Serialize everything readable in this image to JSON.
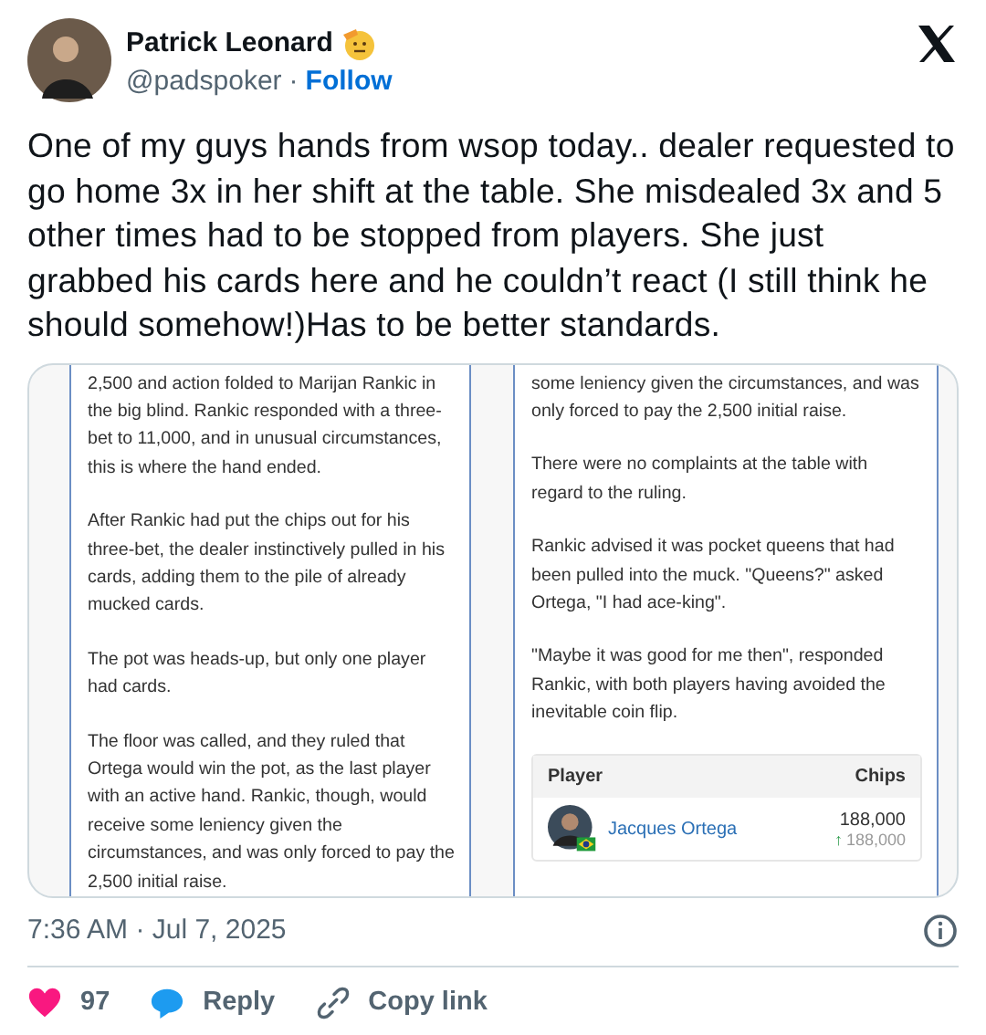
{
  "author": {
    "name": "Patrick Leonard",
    "handle": "@padspoker",
    "separator": "·",
    "follow": "Follow"
  },
  "text": "One of my guys hands from wsop today.. dealer requested to go home 3x in her shift at the table. She misdealed 3x and 5 other times had to be stopped from players. She just grabbed his cards here and he couldn’t react (I still think he should somehow!)Has to be better standards.",
  "article": {
    "columns": [
      {
        "paragraphs": [
          "2,500 and action folded to Marijan Rankic in the big blind. Rankic responded with a three-bet to 11,000, and in unusual circumstances, this is where the hand ended.",
          "After Rankic had put the chips out for his three-bet, the dealer instinctively pulled in his cards, adding them to the pile of already mucked cards.",
          "The pot was heads-up, but only one player had cards.",
          "The floor was called, and they ruled that Ortega would win the pot, as the last player with an active hand. Rankic, though, would receive some leniency given the circumstances, and was only forced to pay the 2,500 initial raise."
        ]
      },
      {
        "paragraphs": [
          "some leniency given the circumstances, and was only forced to pay the 2,500 initial raise.",
          "There were no complaints at the table with regard to the ruling.",
          "Rankic advised it was pocket queens that had been pulled into the muck. \"Queens?\" asked Ortega, \"I had ace-king\".",
          "\"Maybe it was good for me then\", responded Rankic, with both players having avoided the inevitable coin flip."
        ],
        "table": {
          "columns": [
            "Player",
            "Chips"
          ],
          "rows": [
            {
              "player": "Jacques Ortega",
              "chips": "188,000",
              "change_arrow": "↑",
              "change": "188,000"
            }
          ]
        }
      }
    ]
  },
  "timestamp": "7:36 AM · Jul 7, 2025",
  "actions": [
    {
      "kind": "like",
      "label": "97"
    },
    {
      "kind": "reply",
      "label": "Reply"
    },
    {
      "kind": "copy",
      "label": "Copy link"
    }
  ]
}
